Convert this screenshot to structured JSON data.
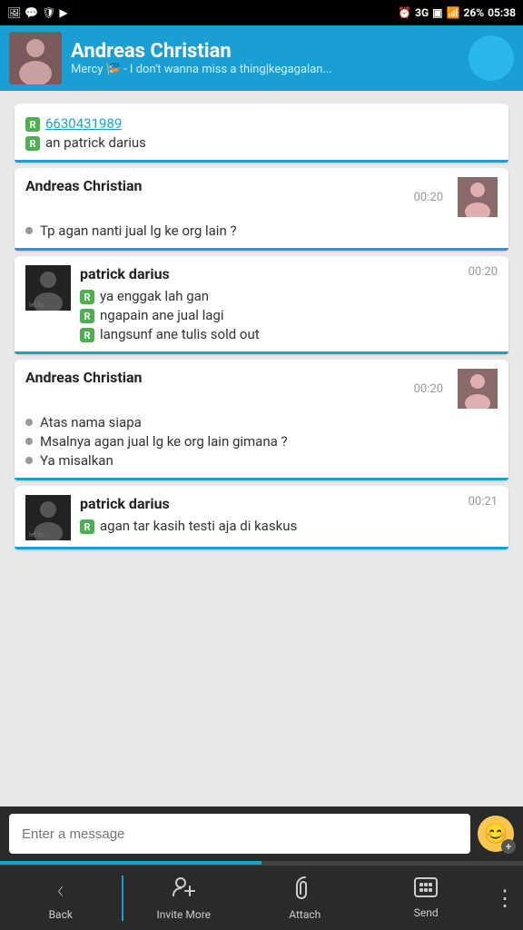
{
  "statusBar": {
    "leftIcons": [
      "🖼",
      "💬",
      "🛡",
      "▶"
    ],
    "alarm": "⏰",
    "network": "3G",
    "sim": "1",
    "signal": "📶",
    "battery": "26%",
    "time": "05:38"
  },
  "header": {
    "name": "Andreas Christian",
    "status": "Mercy 🎏  - I don't wanna miss a thing|kegagalan..."
  },
  "messages": [
    {
      "id": "msg1",
      "type": "other",
      "sender": "",
      "time": "",
      "lines": [
        {
          "badge": "R",
          "text": "6630431989",
          "link": true
        },
        {
          "badge": "R",
          "text": "an patrick darius",
          "link": false
        }
      ]
    },
    {
      "id": "msg2",
      "type": "self",
      "sender": "Andreas Christian",
      "time": "00:20",
      "lines": [
        {
          "bullet": true,
          "text": "Tp agan nanti jual lg ke org lain ?"
        }
      ]
    },
    {
      "id": "msg3",
      "type": "other",
      "sender": "patrick darius",
      "time": "00:20",
      "lines": [
        {
          "badge": "R",
          "text": "ya enggak lah gan"
        },
        {
          "badge": "R",
          "text": "ngapain ane jual lagi"
        },
        {
          "badge": "R",
          "text": "langsunf ane tulis sold out"
        }
      ]
    },
    {
      "id": "msg4",
      "type": "self",
      "sender": "Andreas Christian",
      "time": "00:20",
      "lines": [
        {
          "bullet": true,
          "text": "Atas nama siapa"
        },
        {
          "bullet": true,
          "text": "Msalnya agan jual lg ke org lain gimana ?"
        },
        {
          "bullet": true,
          "text": "Ya misalkan"
        }
      ]
    },
    {
      "id": "msg5",
      "type": "other",
      "sender": "patrick darius",
      "time": "00:21",
      "lines": [
        {
          "badge": "R",
          "text": "agan tar kasih testi aja di kaskus"
        }
      ]
    }
  ],
  "inputBar": {
    "placeholder": "Enter a message"
  },
  "bottomNav": {
    "back": "Back",
    "inviteMore": "Invite More",
    "attach": "Attach",
    "send": "Send"
  }
}
